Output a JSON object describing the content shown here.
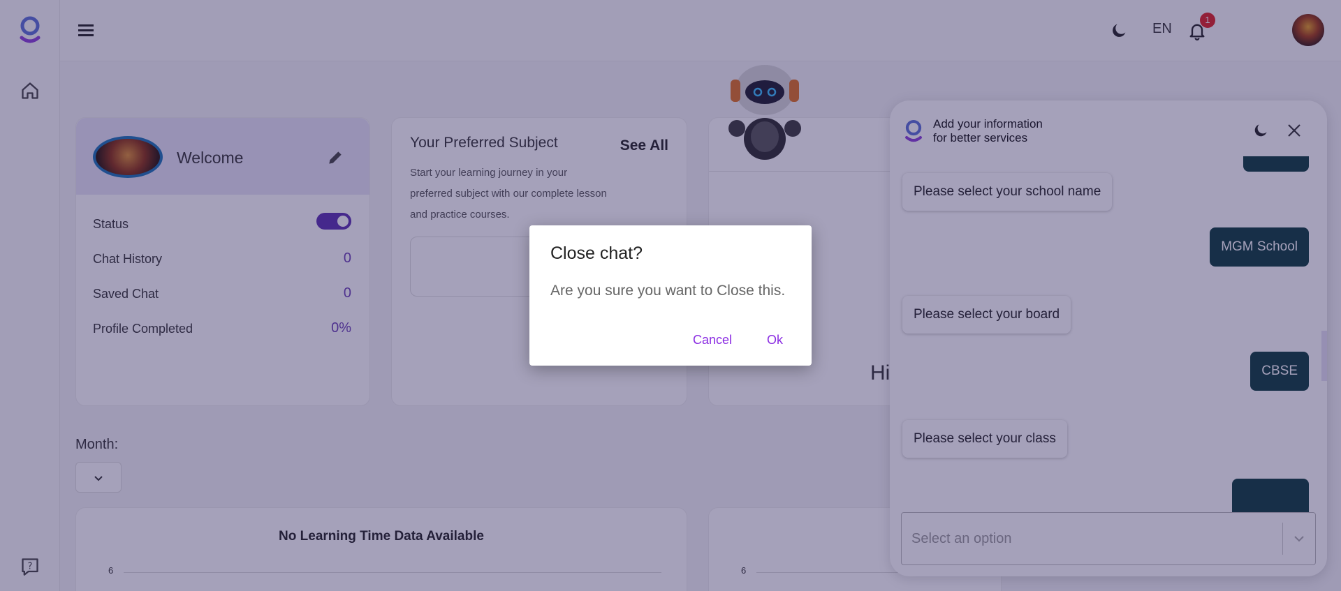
{
  "header": {
    "language": "EN",
    "notification_count": "1"
  },
  "welcome": {
    "title": "Welcome",
    "stats": [
      {
        "label": "Status"
      },
      {
        "label": "Chat History",
        "value": "0"
      },
      {
        "label": "Saved Chat",
        "value": "0"
      },
      {
        "label": "Profile Completed",
        "value": "0%"
      }
    ],
    "status_on": true
  },
  "subject": {
    "title": "Your Preferred Subject",
    "see_all": "See All",
    "description": "Start your learning journey in your preferred subject with our complete lesson and practice courses."
  },
  "greeting_partial": "Hi",
  "month": {
    "label": "Month:"
  },
  "charts": {
    "learning_title": "No Learning Time Data Available",
    "tick_top_left": "6",
    "tick_top_right": "6"
  },
  "chat": {
    "title_line1": "Add your information",
    "title_line2": "for better services",
    "messages": [
      {
        "from": "bot",
        "text": "Please select your school name"
      },
      {
        "from": "user",
        "text": "MGM School"
      },
      {
        "from": "bot",
        "text": "Please select your board"
      },
      {
        "from": "user",
        "text": "CBSE"
      },
      {
        "from": "bot",
        "text": "Please select your class"
      }
    ],
    "select_placeholder": "Select an option"
  },
  "modal": {
    "title": "Close chat?",
    "body": "Are you sure you want to Close this.",
    "cancel": "Cancel",
    "ok": "Ok"
  },
  "colors": {
    "accent": "#5b2fb0",
    "link": "#8a2be2",
    "user_bubble": "#0c3b3b",
    "overlay": "#281e5a"
  }
}
